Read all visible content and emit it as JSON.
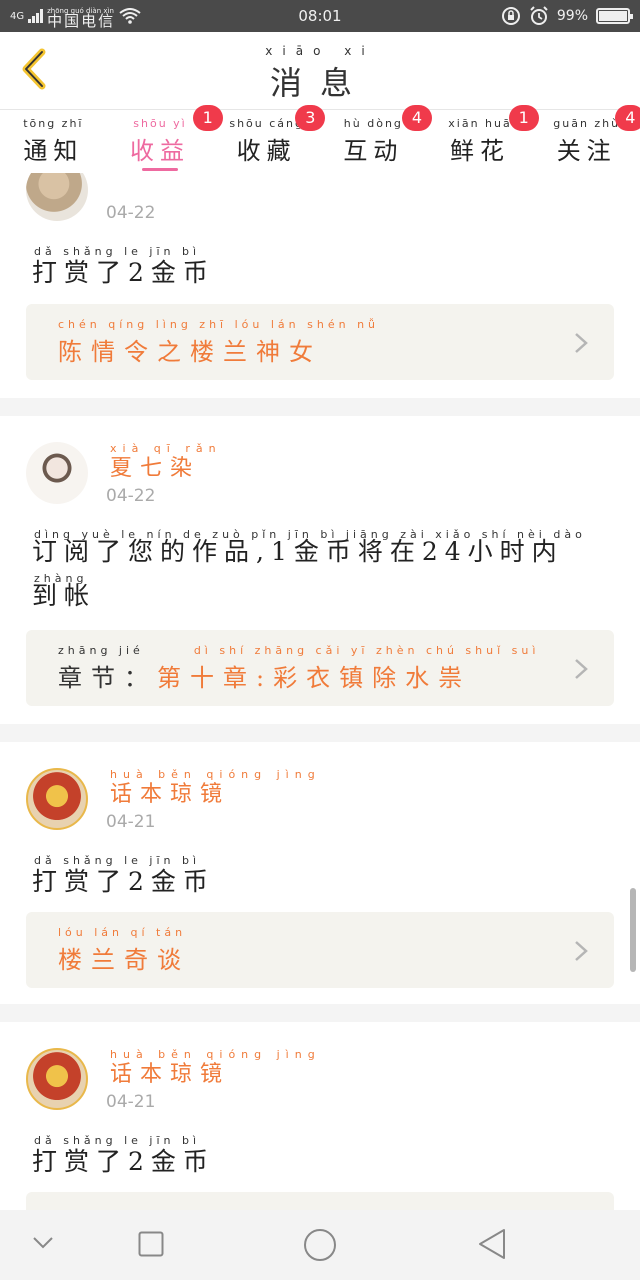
{
  "status_bar": {
    "network": "4G",
    "carrier": "中国电信",
    "carrier_pinyin": "zhōng guó diàn xìn",
    "time": "08:01",
    "battery": "99%",
    "battery_level": 0.99
  },
  "header": {
    "title": "消息",
    "title_pinyin": "xiāo xi"
  },
  "tabs": [
    {
      "label": "通知",
      "pinyin": "tōng zhī",
      "badge": ""
    },
    {
      "label": "收益",
      "pinyin": "shōu yì",
      "badge": "1"
    },
    {
      "label": "收藏",
      "pinyin": "shōu cáng",
      "badge": "3"
    },
    {
      "label": "互动",
      "pinyin": "hù dòng",
      "badge": "4"
    },
    {
      "label": "鲜花",
      "pinyin": "xiān huā",
      "badge": "1"
    },
    {
      "label": "关注",
      "pinyin": "guān zhù",
      "badge": "4"
    }
  ],
  "active_tab": 1,
  "messages": [
    {
      "user": "",
      "user_pinyin": "",
      "date": "04-22",
      "text": "打赏了2金币",
      "text_pinyin": "dǎ shǎng le   jīn bì",
      "ref_label": "",
      "ref_label_pinyin": "",
      "ref_title": "陈情令之楼兰神女",
      "ref_title_pinyin": "chén qíng lìng zhī lóu lán shén nǚ"
    },
    {
      "user": "夏七染",
      "user_pinyin": "xià qī rǎn",
      "date": "04-22",
      "text": "订阅了您的作品,1金币将在24小时内到帐",
      "text_pinyin": "dìng yuè le nín de zuò pǐn   jīn bì jiāng zài   xiǎo shí nèi dào",
      "text_pinyin_2": "zhàng",
      "ref_label": "章节：",
      "ref_label_pinyin": "zhāng jié",
      "ref_title": "第十章:彩衣镇除水祟",
      "ref_title_pinyin": "dì shí zhāng  cǎi yī zhèn chú shuǐ suì"
    },
    {
      "user": "话本琼镜",
      "user_pinyin": "huà běn qióng jìng",
      "date": "04-21",
      "text": "打赏了2金币",
      "text_pinyin": "dǎ shǎng le   jīn bì",
      "ref_label": "",
      "ref_label_pinyin": "",
      "ref_title": "楼兰奇谈",
      "ref_title_pinyin": "lóu lán qí tán"
    },
    {
      "user": "话本琼镜",
      "user_pinyin": "huà běn qióng jìng",
      "date": "04-21",
      "text": "打赏了2金币",
      "text_pinyin": "dǎ shǎng le   jīn bì",
      "ref_label": "",
      "ref_label_pinyin": "",
      "ref_title": "",
      "ref_title_pinyin": ""
    }
  ],
  "nav_bar": {
    "icons": [
      "chevron-down-icon",
      "square-icon",
      "circle-icon",
      "triangle-back-icon"
    ]
  },
  "colors": {
    "accent_pink": "#ee6aa0",
    "orange": "#f07b3a",
    "badge_red": "#f03a4b",
    "status_bar": "#4a4a4a"
  }
}
